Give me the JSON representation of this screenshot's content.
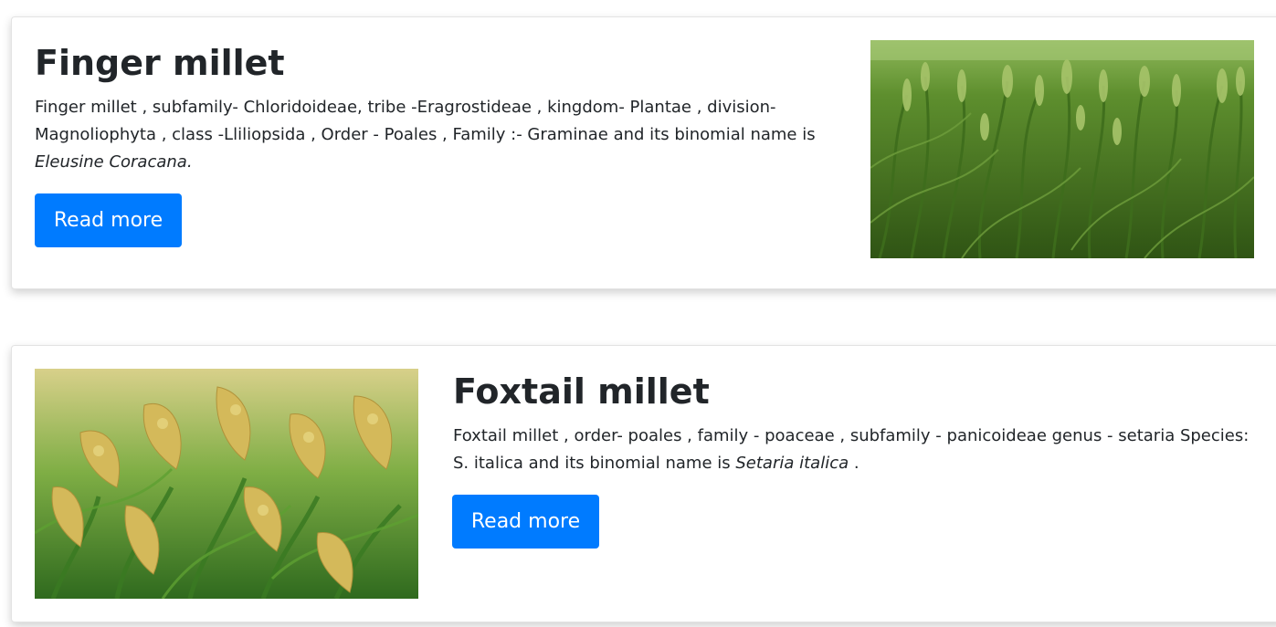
{
  "cards": [
    {
      "title": "Finger millet",
      "description": "Finger millet , subfamily- Chloridoideae, tribe -Eragrostideae , kingdom- Plantae , division- Magnoliophyta , class -Lliliopsida , Order - Poales , Family :- Graminae and its binomial name is ",
      "binomial_name": "Eleusine Coracana.",
      "description_suffix": "",
      "button_label": "Read more",
      "image_subject": "finger-millet-field"
    },
    {
      "title": "Foxtail millet",
      "description": "Foxtail millet , order- poales , family - poaceae , subfamily - panicoideae genus - setaria Species: S. italica and its binomial name is ",
      "binomial_name": "Setaria italica",
      "description_suffix": " .",
      "button_label": "Read more",
      "image_subject": "foxtail-millet-field"
    }
  ],
  "colors": {
    "button_bg": "#007bff",
    "button_text": "#ffffff",
    "text": "#212529",
    "card_border": "#e3e3e3"
  }
}
